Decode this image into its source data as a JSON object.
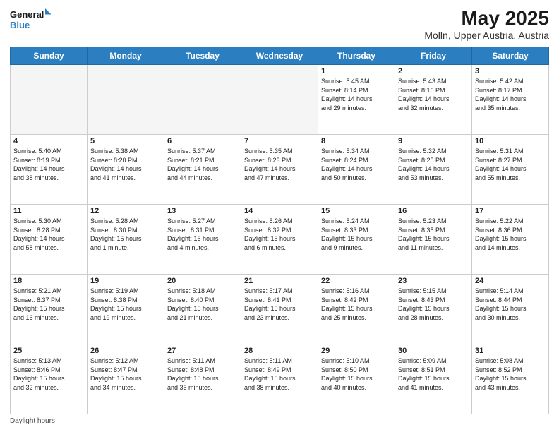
{
  "header": {
    "logo_line1": "General",
    "logo_line2": "Blue",
    "month": "May 2025",
    "location": "Molln, Upper Austria, Austria"
  },
  "weekdays": [
    "Sunday",
    "Monday",
    "Tuesday",
    "Wednesday",
    "Thursday",
    "Friday",
    "Saturday"
  ],
  "weeks": [
    [
      {
        "day": "",
        "info": ""
      },
      {
        "day": "",
        "info": ""
      },
      {
        "day": "",
        "info": ""
      },
      {
        "day": "",
        "info": ""
      },
      {
        "day": "1",
        "info": "Sunrise: 5:45 AM\nSunset: 8:14 PM\nDaylight: 14 hours\nand 29 minutes."
      },
      {
        "day": "2",
        "info": "Sunrise: 5:43 AM\nSunset: 8:16 PM\nDaylight: 14 hours\nand 32 minutes."
      },
      {
        "day": "3",
        "info": "Sunrise: 5:42 AM\nSunset: 8:17 PM\nDaylight: 14 hours\nand 35 minutes."
      }
    ],
    [
      {
        "day": "4",
        "info": "Sunrise: 5:40 AM\nSunset: 8:19 PM\nDaylight: 14 hours\nand 38 minutes."
      },
      {
        "day": "5",
        "info": "Sunrise: 5:38 AM\nSunset: 8:20 PM\nDaylight: 14 hours\nand 41 minutes."
      },
      {
        "day": "6",
        "info": "Sunrise: 5:37 AM\nSunset: 8:21 PM\nDaylight: 14 hours\nand 44 minutes."
      },
      {
        "day": "7",
        "info": "Sunrise: 5:35 AM\nSunset: 8:23 PM\nDaylight: 14 hours\nand 47 minutes."
      },
      {
        "day": "8",
        "info": "Sunrise: 5:34 AM\nSunset: 8:24 PM\nDaylight: 14 hours\nand 50 minutes."
      },
      {
        "day": "9",
        "info": "Sunrise: 5:32 AM\nSunset: 8:25 PM\nDaylight: 14 hours\nand 53 minutes."
      },
      {
        "day": "10",
        "info": "Sunrise: 5:31 AM\nSunset: 8:27 PM\nDaylight: 14 hours\nand 55 minutes."
      }
    ],
    [
      {
        "day": "11",
        "info": "Sunrise: 5:30 AM\nSunset: 8:28 PM\nDaylight: 14 hours\nand 58 minutes."
      },
      {
        "day": "12",
        "info": "Sunrise: 5:28 AM\nSunset: 8:30 PM\nDaylight: 15 hours\nand 1 minute."
      },
      {
        "day": "13",
        "info": "Sunrise: 5:27 AM\nSunset: 8:31 PM\nDaylight: 15 hours\nand 4 minutes."
      },
      {
        "day": "14",
        "info": "Sunrise: 5:26 AM\nSunset: 8:32 PM\nDaylight: 15 hours\nand 6 minutes."
      },
      {
        "day": "15",
        "info": "Sunrise: 5:24 AM\nSunset: 8:33 PM\nDaylight: 15 hours\nand 9 minutes."
      },
      {
        "day": "16",
        "info": "Sunrise: 5:23 AM\nSunset: 8:35 PM\nDaylight: 15 hours\nand 11 minutes."
      },
      {
        "day": "17",
        "info": "Sunrise: 5:22 AM\nSunset: 8:36 PM\nDaylight: 15 hours\nand 14 minutes."
      }
    ],
    [
      {
        "day": "18",
        "info": "Sunrise: 5:21 AM\nSunset: 8:37 PM\nDaylight: 15 hours\nand 16 minutes."
      },
      {
        "day": "19",
        "info": "Sunrise: 5:19 AM\nSunset: 8:38 PM\nDaylight: 15 hours\nand 19 minutes."
      },
      {
        "day": "20",
        "info": "Sunrise: 5:18 AM\nSunset: 8:40 PM\nDaylight: 15 hours\nand 21 minutes."
      },
      {
        "day": "21",
        "info": "Sunrise: 5:17 AM\nSunset: 8:41 PM\nDaylight: 15 hours\nand 23 minutes."
      },
      {
        "day": "22",
        "info": "Sunrise: 5:16 AM\nSunset: 8:42 PM\nDaylight: 15 hours\nand 25 minutes."
      },
      {
        "day": "23",
        "info": "Sunrise: 5:15 AM\nSunset: 8:43 PM\nDaylight: 15 hours\nand 28 minutes."
      },
      {
        "day": "24",
        "info": "Sunrise: 5:14 AM\nSunset: 8:44 PM\nDaylight: 15 hours\nand 30 minutes."
      }
    ],
    [
      {
        "day": "25",
        "info": "Sunrise: 5:13 AM\nSunset: 8:46 PM\nDaylight: 15 hours\nand 32 minutes."
      },
      {
        "day": "26",
        "info": "Sunrise: 5:12 AM\nSunset: 8:47 PM\nDaylight: 15 hours\nand 34 minutes."
      },
      {
        "day": "27",
        "info": "Sunrise: 5:11 AM\nSunset: 8:48 PM\nDaylight: 15 hours\nand 36 minutes."
      },
      {
        "day": "28",
        "info": "Sunrise: 5:11 AM\nSunset: 8:49 PM\nDaylight: 15 hours\nand 38 minutes."
      },
      {
        "day": "29",
        "info": "Sunrise: 5:10 AM\nSunset: 8:50 PM\nDaylight: 15 hours\nand 40 minutes."
      },
      {
        "day": "30",
        "info": "Sunrise: 5:09 AM\nSunset: 8:51 PM\nDaylight: 15 hours\nand 41 minutes."
      },
      {
        "day": "31",
        "info": "Sunrise: 5:08 AM\nSunset: 8:52 PM\nDaylight: 15 hours\nand 43 minutes."
      }
    ]
  ],
  "footer": "Daylight hours"
}
